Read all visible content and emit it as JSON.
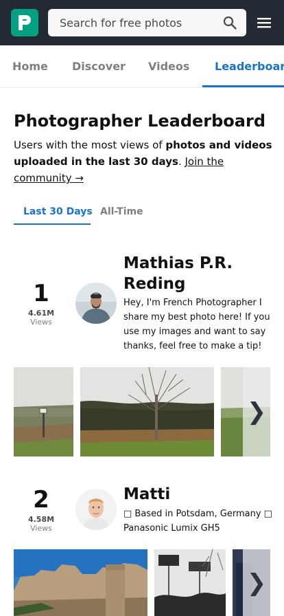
{
  "header": {
    "search_placeholder": "Search for free photos",
    "logo_letter": "P"
  },
  "nav": {
    "tabs": [
      {
        "label": "Home"
      },
      {
        "label": "Discover"
      },
      {
        "label": "Videos"
      },
      {
        "label": "Leaderboard"
      }
    ],
    "active_tab": "Leaderboard"
  },
  "page": {
    "title": "Photographer Leaderboard",
    "subtitle_pre": "Users with the most views of ",
    "subtitle_bold": "photos and videos uploaded in the last 30 days",
    "subtitle_post": ". ",
    "subtitle_link": "Join the community →"
  },
  "period_tabs": [
    {
      "label": "Last 30 Days"
    },
    {
      "label": "All-Time"
    }
  ],
  "active_period": "Last 30 Days",
  "entries": [
    {
      "rank": "1",
      "views": "4.61M",
      "views_label": "Views",
      "name": "Mathias P.R. Reding",
      "bio": "Hey, I'm French Photographer I share my best photo here! If you use my images and want to say thanks, feel free to make a tip!"
    },
    {
      "rank": "2",
      "views": "4.58M",
      "views_label": "Views",
      "name": "Matti",
      "bio": "□ Based in Potsdam, Germany □ Panasonic Lumix GH5"
    }
  ],
  "gallery_next_glyph": "❯",
  "colors": {
    "brand": "#05a081",
    "header_bg": "#232a34",
    "accent": "#1a73c8"
  }
}
